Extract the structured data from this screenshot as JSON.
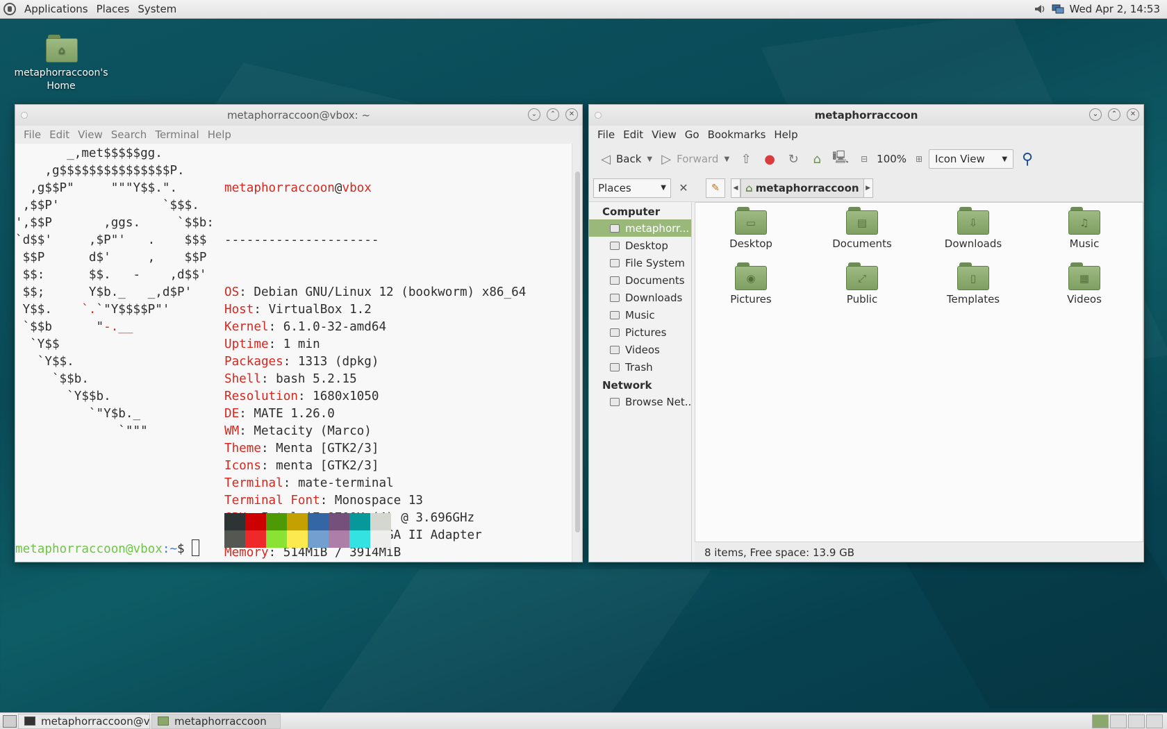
{
  "top_panel": {
    "menus": [
      "Applications",
      "Places",
      "System"
    ],
    "clock": "Wed Apr  2, 14:53",
    "icons": [
      "volume-icon",
      "network-icon"
    ]
  },
  "desktop": {
    "home_icon_label": "metaphorraccoon's Home"
  },
  "terminal": {
    "title": "metaphorraccoon@vbox: ~",
    "menus": [
      "File",
      "Edit",
      "View",
      "Search",
      "Terminal",
      "Help"
    ],
    "logo_lines": [
      "       _,met$$$$$gg.",
      "    ,g$$$$$$$$$$$$$$$P.",
      "  ,g$$P\"     \"\"\"Y$$.\".",
      " ,$$P'              `$$$.",
      "',$$P       ,ggs.     `$$b:",
      "`d$$'     ,$P\"'   .    $$$",
      " $$P      d$'     ,    $$P",
      " $$:      $$.   -    ,d$$'",
      " $$;      Y$b._   _,d$P'",
      " Y$$.    `.`\"Y$$$$P\"'",
      " `$$b      \"-.__",
      "  `Y$$",
      "   `Y$$.",
      "     `$$b.",
      "       `Y$$b.",
      "          `\"Y$b._",
      "              `\"\"\""
    ],
    "user": "metaphorraccoon",
    "at": "@",
    "host": "vbox",
    "separator": "---------------------",
    "info": [
      {
        "key": "OS",
        "value": "Debian GNU/Linux 12 (bookworm) x86_64"
      },
      {
        "key": "Host",
        "value": "VirtualBox 1.2"
      },
      {
        "key": "Kernel",
        "value": "6.1.0-32-amd64"
      },
      {
        "key": "Uptime",
        "value": "1 min"
      },
      {
        "key": "Packages",
        "value": "1313 (dpkg)"
      },
      {
        "key": "Shell",
        "value": "bash 5.2.15"
      },
      {
        "key": "Resolution",
        "value": "1680x1050"
      },
      {
        "key": "DE",
        "value": "MATE 1.26.0"
      },
      {
        "key": "WM",
        "value": "Metacity (Marco)"
      },
      {
        "key": "Theme",
        "value": "Menta [GTK2/3]"
      },
      {
        "key": "Icons",
        "value": "menta [GTK2/3]"
      },
      {
        "key": "Terminal",
        "value": "mate-terminal"
      },
      {
        "key": "Terminal Font",
        "value": "Monospace 13"
      },
      {
        "key": "CPU",
        "value": "Intel i7-8700K (4) @ 3.696GHz"
      },
      {
        "key": "GPU",
        "value": "00:02.0 VMware SVGA II Adapter"
      },
      {
        "key": "Memory",
        "value": "514MiB / 3914MiB"
      }
    ],
    "palette_top": [
      "#2e3436",
      "#cc0000",
      "#4e9a06",
      "#c4a000",
      "#3465a4",
      "#75507b",
      "#06989a",
      "#d3d7cf"
    ],
    "palette_bottom": [
      "#555753",
      "#ef2929",
      "#8ae234",
      "#fce94f",
      "#729fcf",
      "#ad7fa8",
      "#34e2e2",
      "#eeeeec"
    ],
    "prompt_user": "metaphorraccoon@vbox",
    "prompt_path": ":~",
    "prompt_symbol": "$ "
  },
  "file_manager": {
    "title": "metaphorraccoon",
    "menus": [
      "File",
      "Edit",
      "View",
      "Go",
      "Bookmarks",
      "Help"
    ],
    "toolbar": {
      "back": "Back",
      "forward": "Forward",
      "zoom": "100%",
      "view_mode": "Icon View"
    },
    "places_label": "Places",
    "path_crumb": "metaphorraccoon",
    "sidebar": {
      "computer_heading": "Computer",
      "computer_items": [
        "metaphorr...",
        "Desktop",
        "File System",
        "Documents",
        "Downloads",
        "Music",
        "Pictures",
        "Videos",
        "Trash"
      ],
      "network_heading": "Network",
      "network_items": [
        "Browse Net..."
      ]
    },
    "files": [
      {
        "name": "Desktop",
        "emblem": "▭"
      },
      {
        "name": "Documents",
        "emblem": "▤"
      },
      {
        "name": "Downloads",
        "emblem": "⇩"
      },
      {
        "name": "Music",
        "emblem": "♫"
      },
      {
        "name": "Pictures",
        "emblem": "◉"
      },
      {
        "name": "Public",
        "emblem": "⤢"
      },
      {
        "name": "Templates",
        "emblem": "▯"
      },
      {
        "name": "Videos",
        "emblem": "▦"
      }
    ],
    "status": "8 items, Free space: 13.9 GB"
  },
  "taskbar": {
    "tasks": [
      "metaphorraccoon@v...",
      "metaphorraccoon"
    ]
  },
  "colors": {
    "accent_green": "#9ab87a",
    "terminal_red": "#d6281f",
    "prompt_green": "#6cc644"
  }
}
